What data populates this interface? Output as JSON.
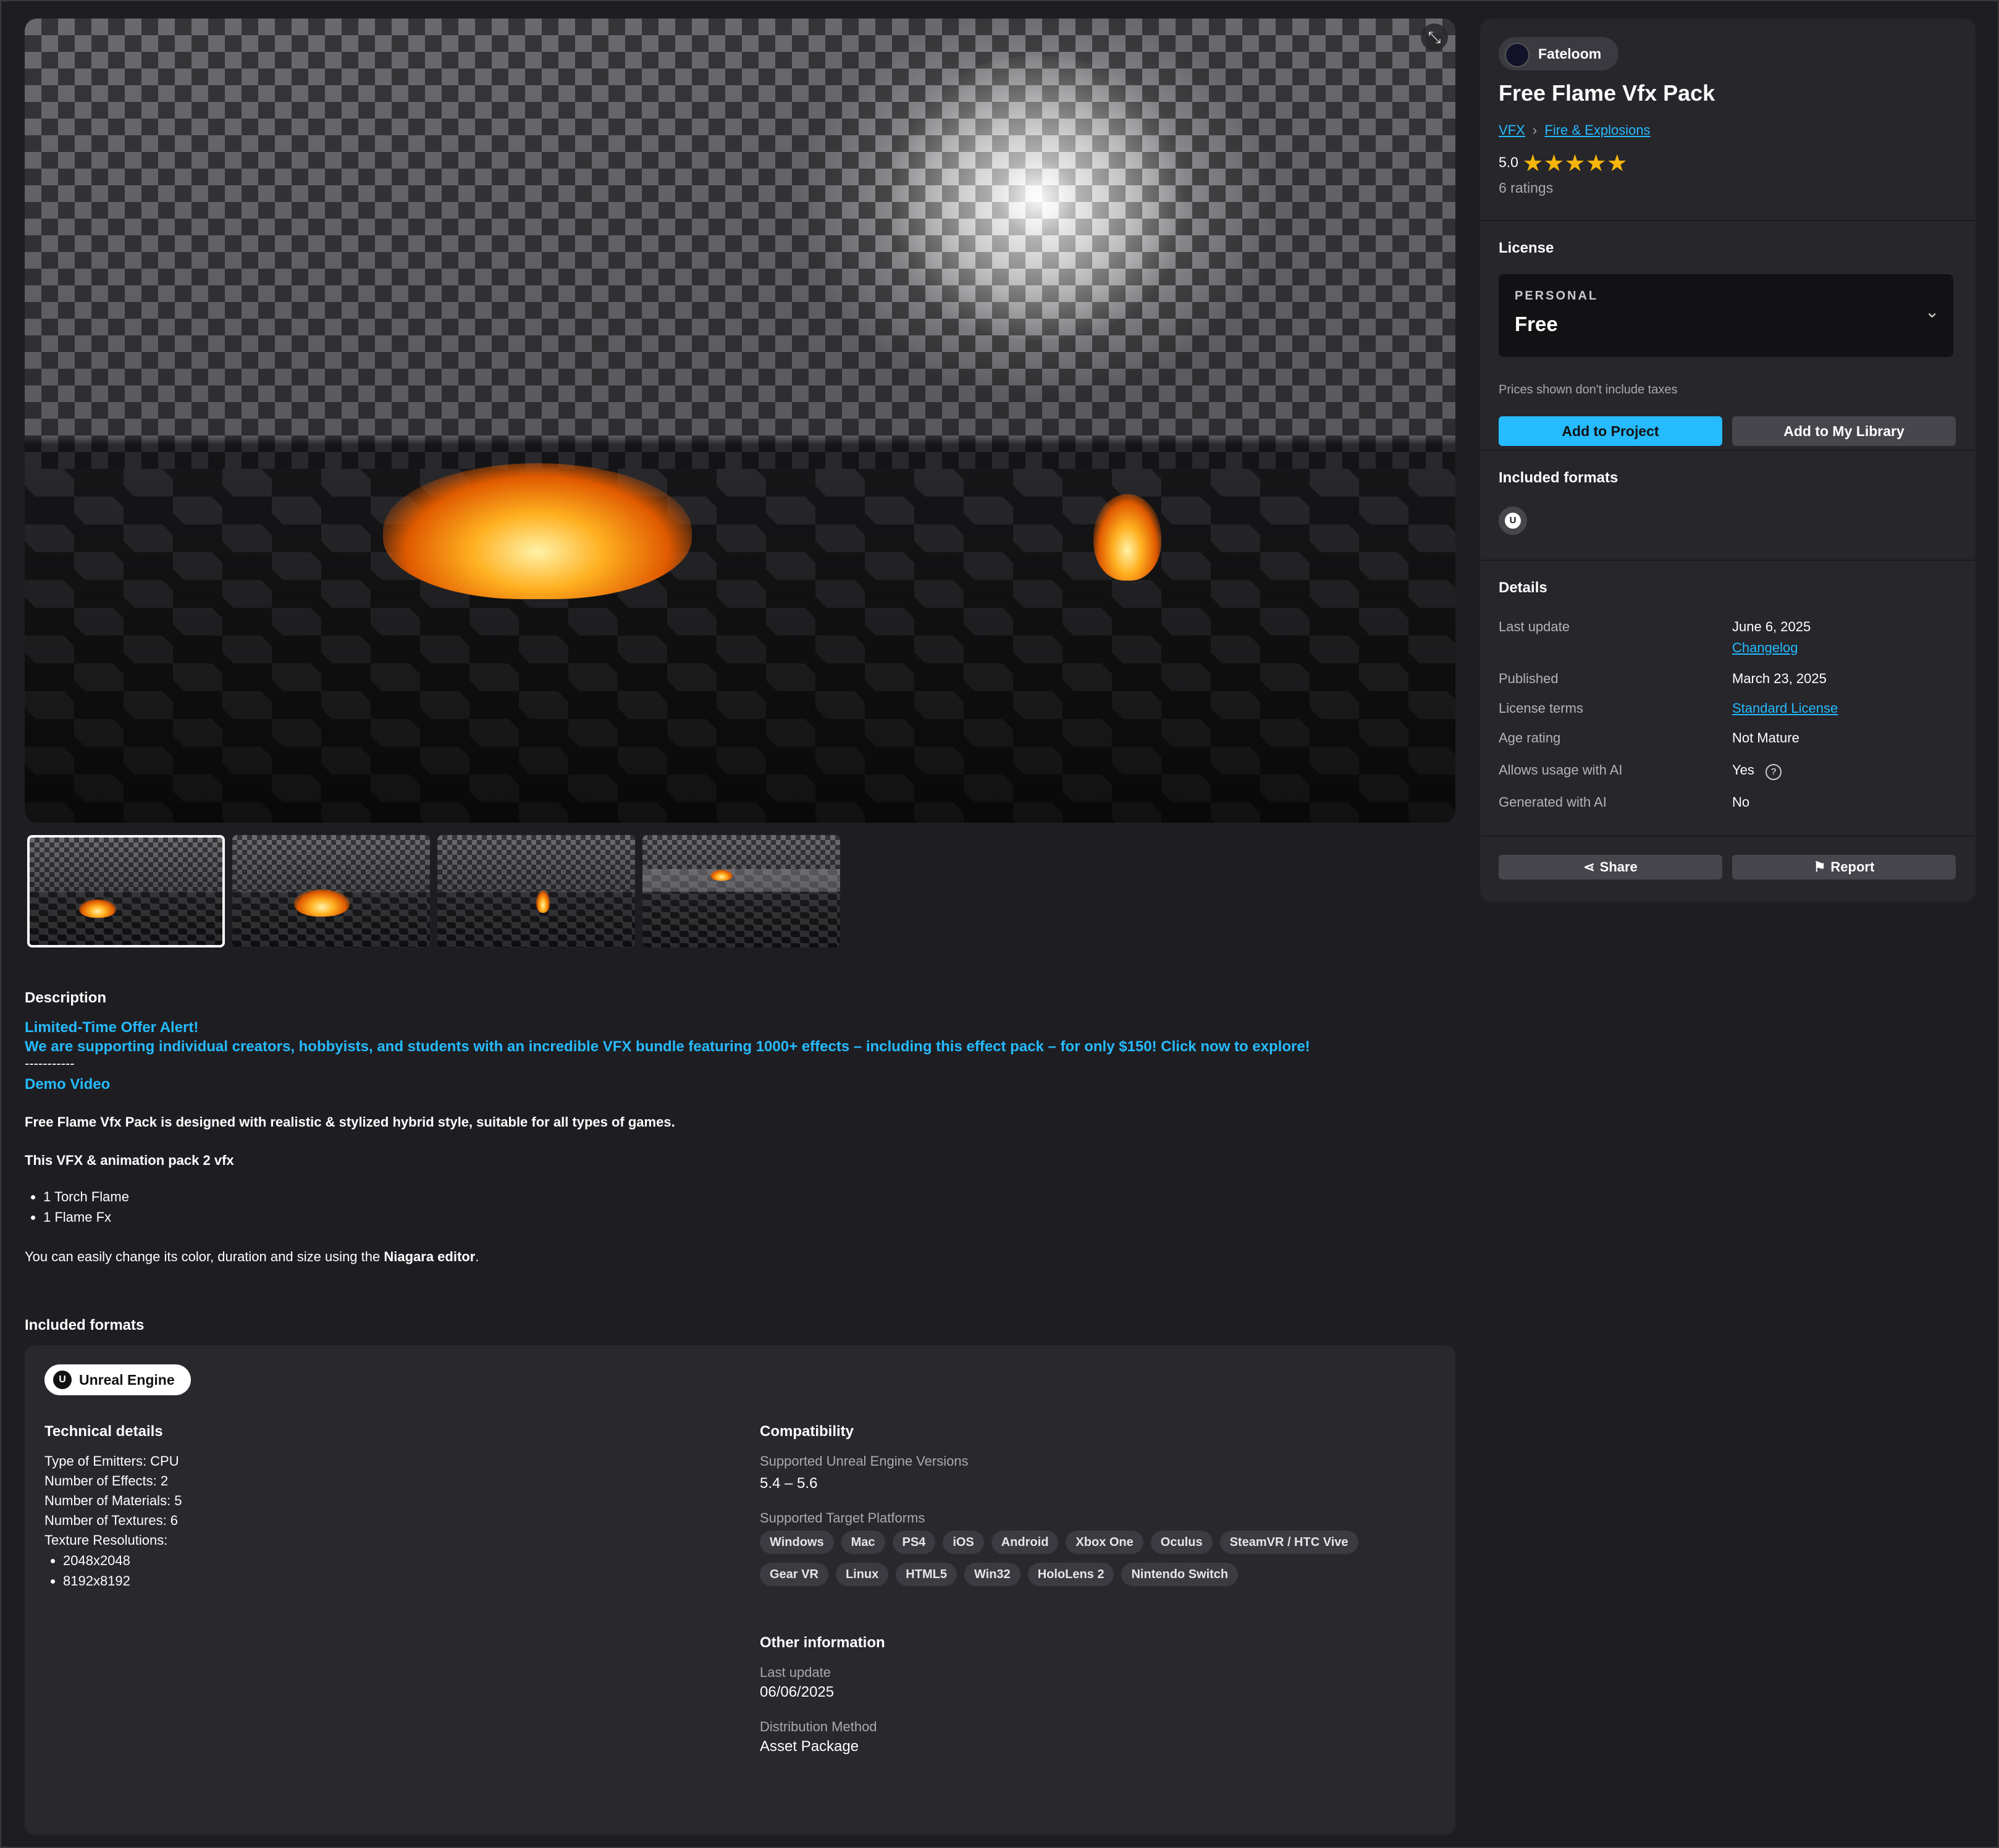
{
  "seller": {
    "name": "Fateloom"
  },
  "product": {
    "title": "Free Flame Vfx Pack",
    "breadcrumb": [
      "VFX",
      "Fire & Explosions"
    ],
    "rating": "5.0",
    "ratings_count": "6 ratings",
    "stars": 5
  },
  "license": {
    "heading": "License",
    "tier": "PERSONAL",
    "price": "Free",
    "tax_note": "Prices shown don't include taxes",
    "add_project": "Add to Project",
    "add_library": "Add to My Library"
  },
  "included_formats_side": {
    "heading": "Included formats",
    "icon": "unreal-engine-icon"
  },
  "details": {
    "heading": "Details",
    "rows": [
      {
        "label": "Last update",
        "value": "June 6, 2025",
        "link": "Changelog"
      },
      {
        "label": "Published",
        "value": "March 23, 2025"
      },
      {
        "label": "License terms",
        "link_value": "Standard License"
      },
      {
        "label": "Age rating",
        "value": "Not Mature"
      },
      {
        "label": "Allows usage with AI",
        "value": "Yes"
      },
      {
        "label": "Generated with AI",
        "value": "No"
      }
    ]
  },
  "actions": {
    "share": "Share",
    "report": "Report"
  },
  "description": {
    "heading": "Description",
    "offer_title": "Limited-Time Offer Alert!",
    "offer_text": "We are supporting individual creators, hobbyists, and students with an incredible VFX bundle featuring 1000+ effects – including this effect pack – for only $150! Click now to explore!",
    "divider": "-----------",
    "demo_link": "Demo Video",
    "intro": "Free Flame Vfx Pack is designed with realistic & stylized hybrid style, suitable for all types of games.",
    "pack_line": "This VFX & animation pack 2 vfx",
    "items": [
      "1 Torch Flame",
      "1 Flame Fx"
    ],
    "editor_prefix": "You can easily change its color, duration and size using the ",
    "editor_name": "Niagara editor",
    "editor_suffix": "."
  },
  "formats": {
    "heading": "Included formats",
    "engine": "Unreal Engine",
    "technical": {
      "heading": "Technical details",
      "lines": [
        "Type of Emitters: CPU",
        "Number of Effects: 2",
        "Number of Materials: 5",
        "Number of Textures: 6",
        "Texture Resolutions:"
      ],
      "resolutions": [
        "2048x2048",
        "8192x8192"
      ]
    },
    "compat": {
      "heading": "Compatibility",
      "versions_label": "Supported Unreal Engine Versions",
      "versions": "5.4 – 5.6",
      "platforms_label": "Supported Target Platforms",
      "platforms_row1": [
        "Windows",
        "Mac",
        "PS4",
        "iOS",
        "Android",
        "Xbox One",
        "Oculus",
        "SteamVR / HTC Vive"
      ],
      "platforms_row2": [
        "Gear VR",
        "Linux",
        "HTML5",
        "Win32",
        "HoloLens 2",
        "Nintendo Switch"
      ]
    },
    "other": {
      "heading": "Other information",
      "last_update_label": "Last update",
      "last_update": "06/06/2025",
      "distribution_label": "Distribution Method",
      "distribution": "Asset Package"
    }
  },
  "colors": {
    "accent": "#26bbff",
    "star": "#f5b50a",
    "bg": "#1e1e22",
    "panel": "#26262b"
  }
}
